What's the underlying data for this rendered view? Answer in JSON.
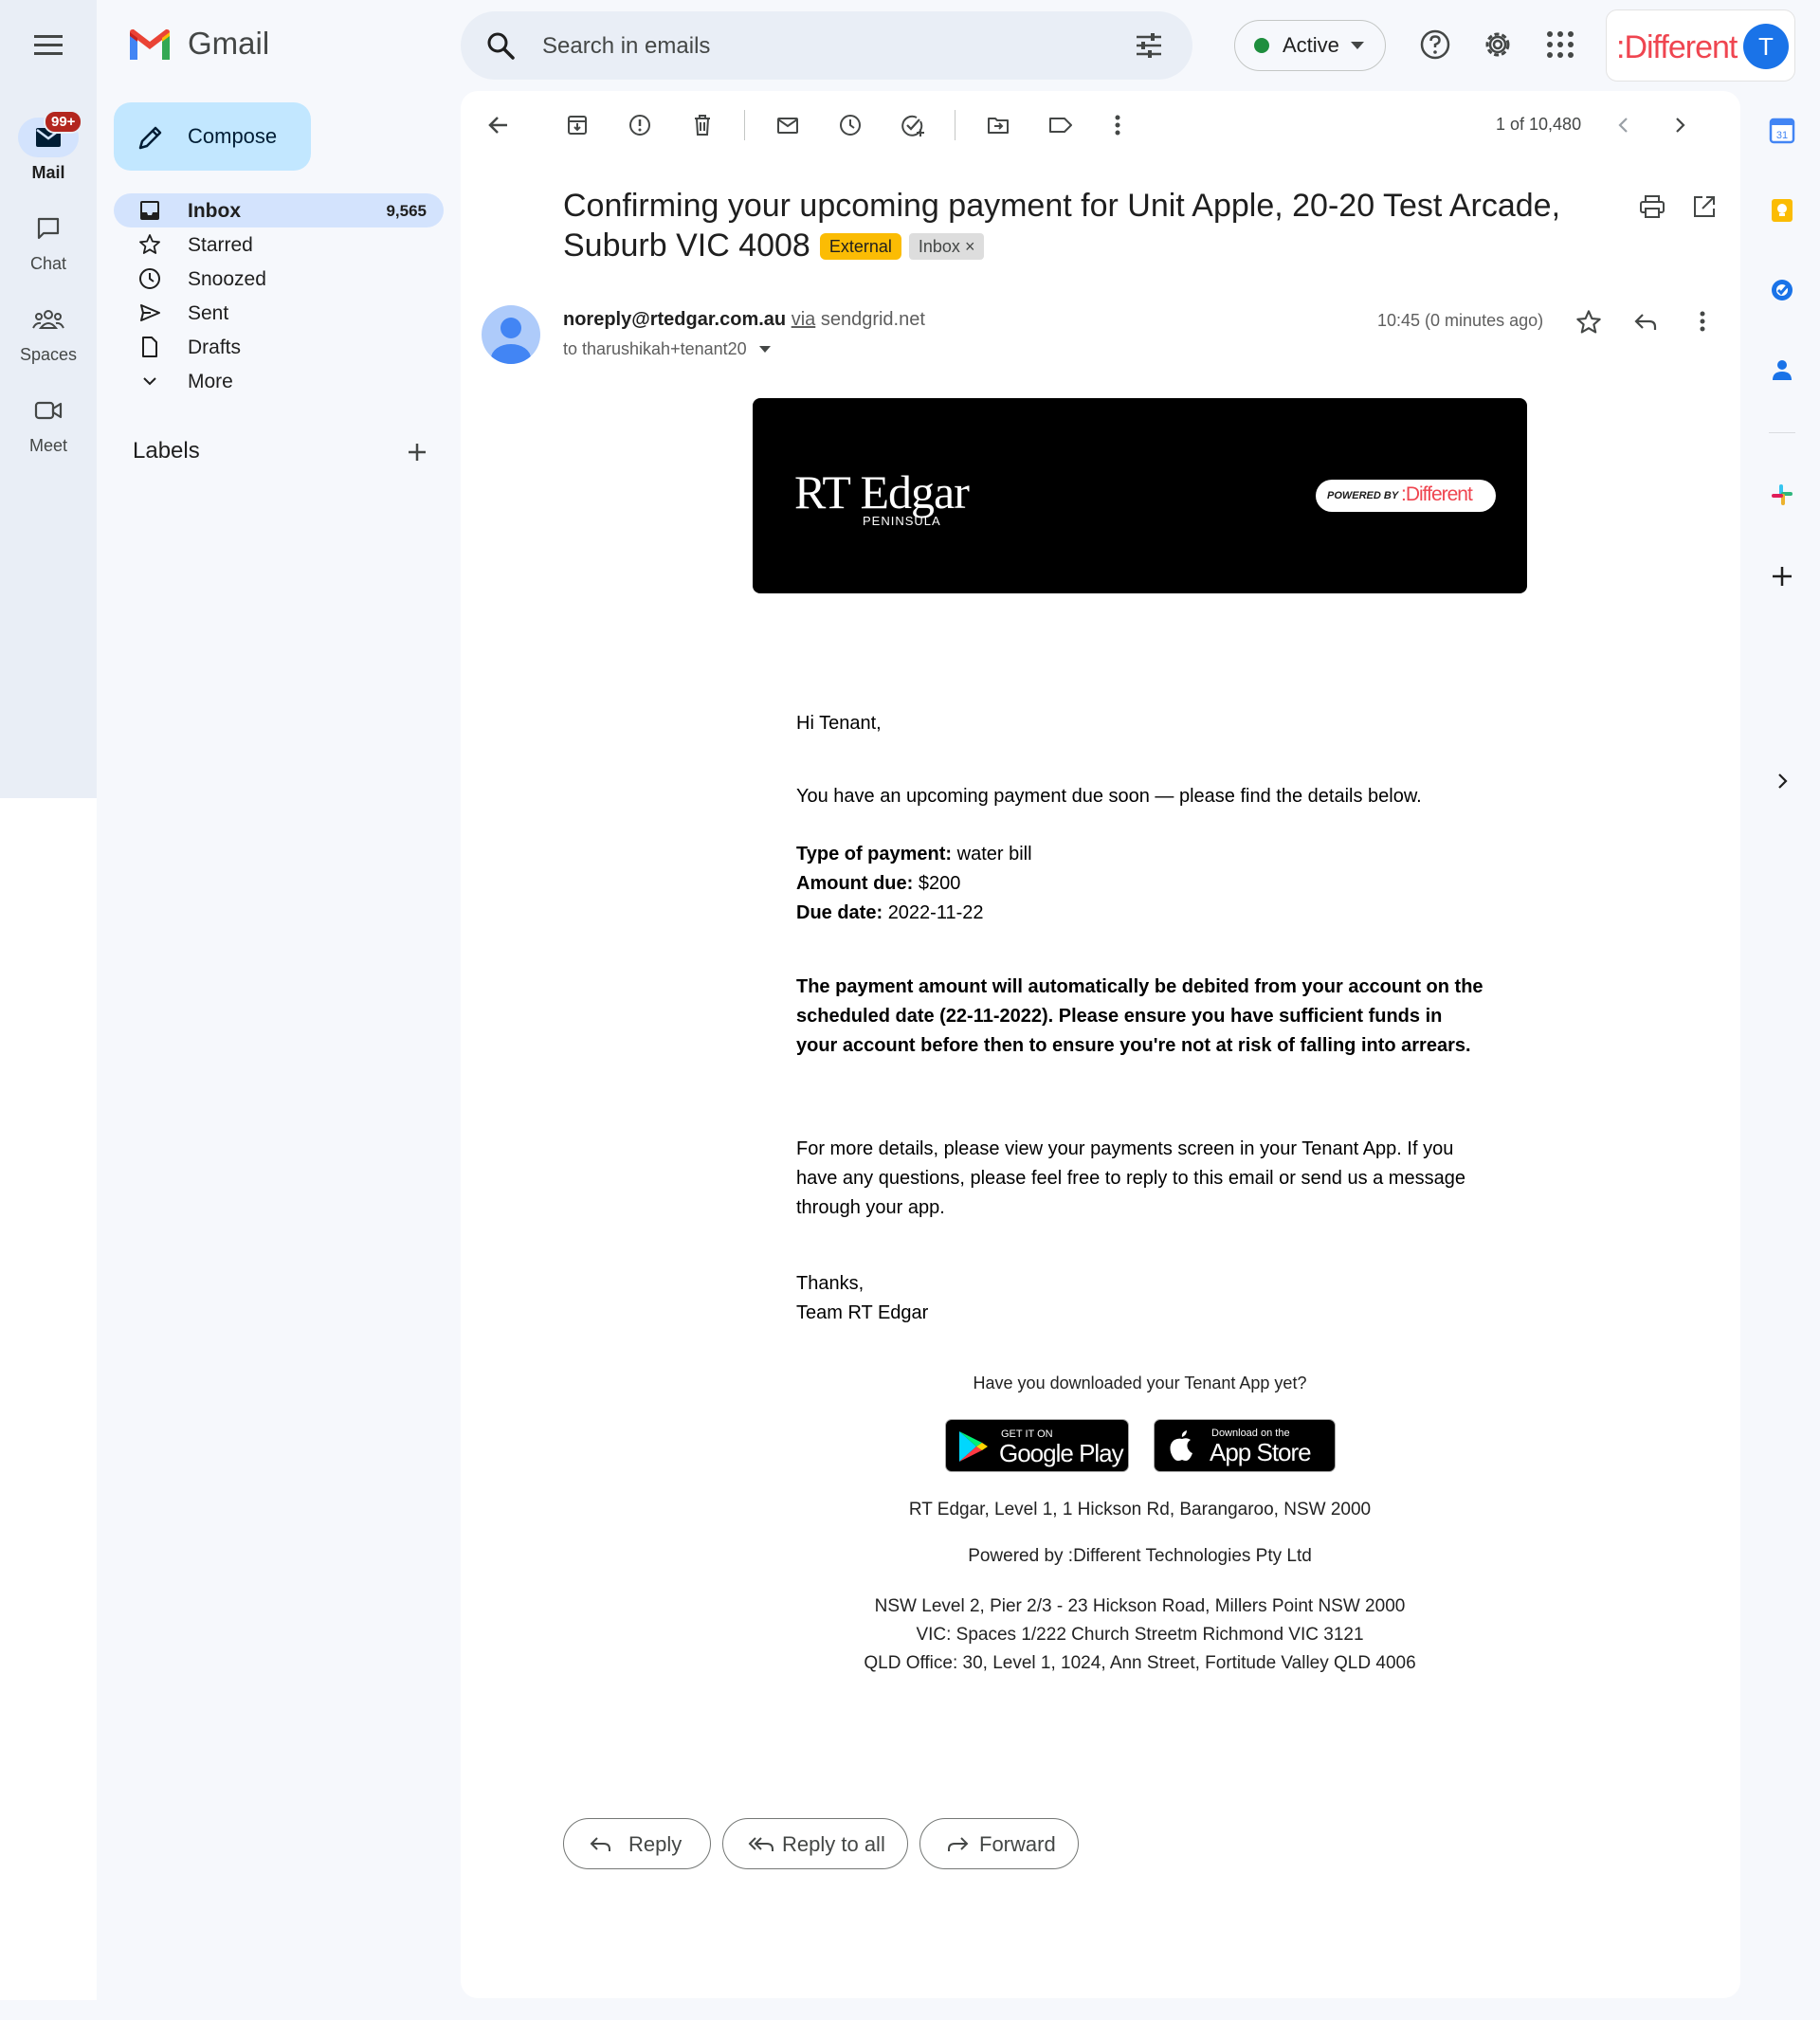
{
  "header": {
    "app_name": "Gmail",
    "search_placeholder": "Search in emails",
    "status": "Active",
    "brand": ":Different",
    "avatar_letter": "T"
  },
  "rail": {
    "items": [
      {
        "label": "Mail",
        "badge": "99+"
      },
      {
        "label": "Chat"
      },
      {
        "label": "Spaces"
      },
      {
        "label": "Meet"
      }
    ]
  },
  "nav": {
    "compose": "Compose",
    "items": [
      {
        "label": "Inbox",
        "count": "9,565"
      },
      {
        "label": "Starred"
      },
      {
        "label": "Snoozed"
      },
      {
        "label": "Sent"
      },
      {
        "label": "Drafts"
      },
      {
        "label": "More"
      }
    ],
    "labels_title": "Labels"
  },
  "toolbar": {
    "pager": "1 of 10,480"
  },
  "email": {
    "subject": "Confirming your upcoming payment for Unit Apple, 20-20 Test Arcade, Suburb VIC 4008",
    "tag_external": "External",
    "tag_inbox": "Inbox",
    "tag_inbox_close": "×",
    "sender": "noreply@rtedgar.com.au",
    "via": "via",
    "via_domain": "sendgrid.net",
    "to": "to tharushikah+tenant20",
    "time": "10:45 (0 minutes ago)"
  },
  "content": {
    "hero_logo": "RT Edgar",
    "hero_sub": "PENINSULA",
    "powered_small": "POWERED BY",
    "powered_brand": ":Different",
    "greeting": "Hi Tenant,",
    "intro": "You have an upcoming payment due soon — please find the details below.",
    "details": [
      {
        "key": "Type of payment:",
        "value": "water bill"
      },
      {
        "key": "Amount due:",
        "value": "$200"
      },
      {
        "key": "Due date:",
        "value": "2022-11-22"
      }
    ],
    "warning": "The payment amount will automatically be debited from your account on the scheduled date (22-11-2022). Please ensure you have sufficient funds in your account before then to ensure you're not at risk of falling into arrears.",
    "more_details": "For more details, please view your payments screen in your Tenant App. If you have any questions, please feel free to reply to this email or send us a message through your app.",
    "thanks": "Thanks,",
    "team": "Team RT Edgar",
    "app_question": "Have you downloaded your Tenant App yet?",
    "google_small": "GET IT ON",
    "google_big": "Google Play",
    "apple_small": "Download on the",
    "apple_big": "App Store",
    "address": "RT Edgar, Level 1, 1 Hickson Rd, Barangaroo, NSW 2000",
    "powered_line": "Powered by :Different Technologies Pty Ltd",
    "office_nsw": "NSW Level 2, Pier 2/3 - 23 Hickson Road, Millers Point NSW 2000",
    "office_vic": "VIC: Spaces 1/222 Church Streetm Richmond VIC 3121",
    "office_qld": "QLD Office: 30, Level 1, 1024, Ann Street, Fortitude Valley QLD 4006"
  },
  "actions": {
    "reply": "Reply",
    "reply_all": "Reply to all",
    "forward": "Forward"
  },
  "side": {
    "calendar_day": "31"
  },
  "colors": {
    "accent": "#1a73e8",
    "compose_bg": "#c2e7ff",
    "active_nav": "#d3e3fd",
    "external_tag": "#fbbc04",
    "brand_red": "#ef4550"
  }
}
